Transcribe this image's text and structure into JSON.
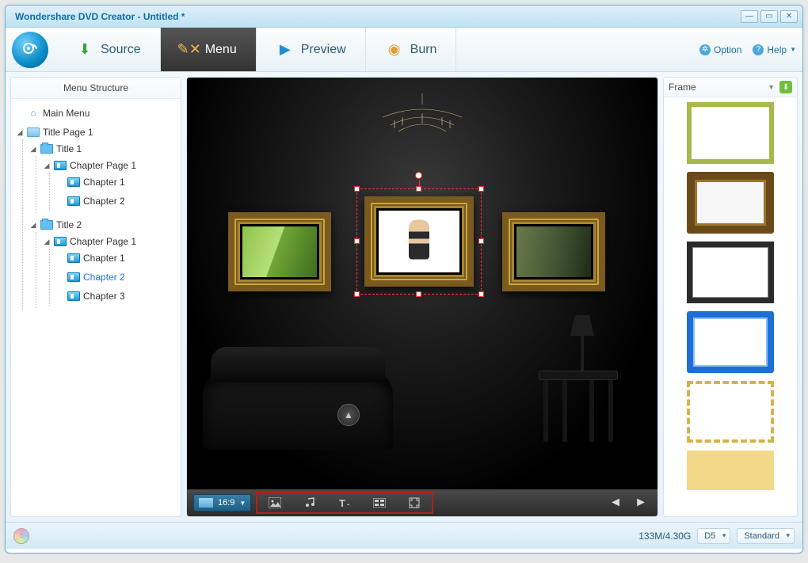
{
  "window": {
    "title": "Wondershare DVD Creator - Untitled *"
  },
  "tabs": {
    "source": "Source",
    "menu": "Menu",
    "preview": "Preview",
    "burn": "Burn",
    "active": "menu"
  },
  "headerLinks": {
    "option": "Option",
    "help": "Help"
  },
  "sidebar": {
    "header": "Menu Structure",
    "tree": {
      "mainMenu": "Main Menu",
      "titlePage1": "Title Page 1",
      "title1": "Title 1",
      "chapterPage1a": "Chapter Page 1",
      "chapter1a": "Chapter 1",
      "chapter2a": "Chapter 2",
      "title2": "Title 2",
      "chapterPage1b": "Chapter Page 1",
      "chapter1b": "Chapter 1",
      "chapter2b": "Chapter 2",
      "chapter3b": "Chapter 3"
    },
    "selected": "chapter2b"
  },
  "canvas": {
    "aspectRatio": "16:9",
    "tools": [
      "background-icon",
      "music-icon",
      "text-icon",
      "thumbnail-icon",
      "fullscreen-icon"
    ]
  },
  "rightPanel": {
    "header": "Frame"
  },
  "status": {
    "faint": "",
    "size": "133M/4.30G",
    "disc": "D5",
    "quality": "Standard"
  }
}
